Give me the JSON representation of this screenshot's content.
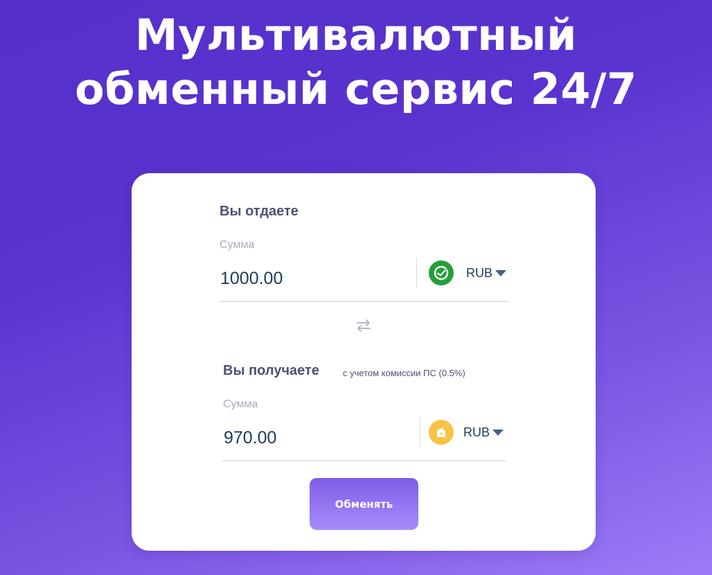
{
  "hero": {
    "title_line1": "Мультивалютный",
    "title_line2": "обменный сервис 24/7"
  },
  "give": {
    "title": "Вы отдаете",
    "amount_label": "Сумма",
    "amount_value": "1000.00",
    "currency": "RUB",
    "bank_icon": "sberbank-logo-icon",
    "bank_color": "#21a038"
  },
  "receive": {
    "title": "Вы получаете",
    "note": "с учетом комиссии ПС (0.5%)",
    "amount_label": "Сумма",
    "amount_value": "970.00",
    "currency": "RUB",
    "bank_icon": "yandex-money-logo-icon",
    "bank_color": "#f6c344"
  },
  "swap_icon": "swap-arrows-icon",
  "submit_label": "Обменять",
  "colors": {
    "background_start": "#5530c9",
    "background_end": "#9c7bf7",
    "accent_button": "#8f73f2",
    "text_dark": "#1e3a5a",
    "text_label": "#4a5272"
  }
}
